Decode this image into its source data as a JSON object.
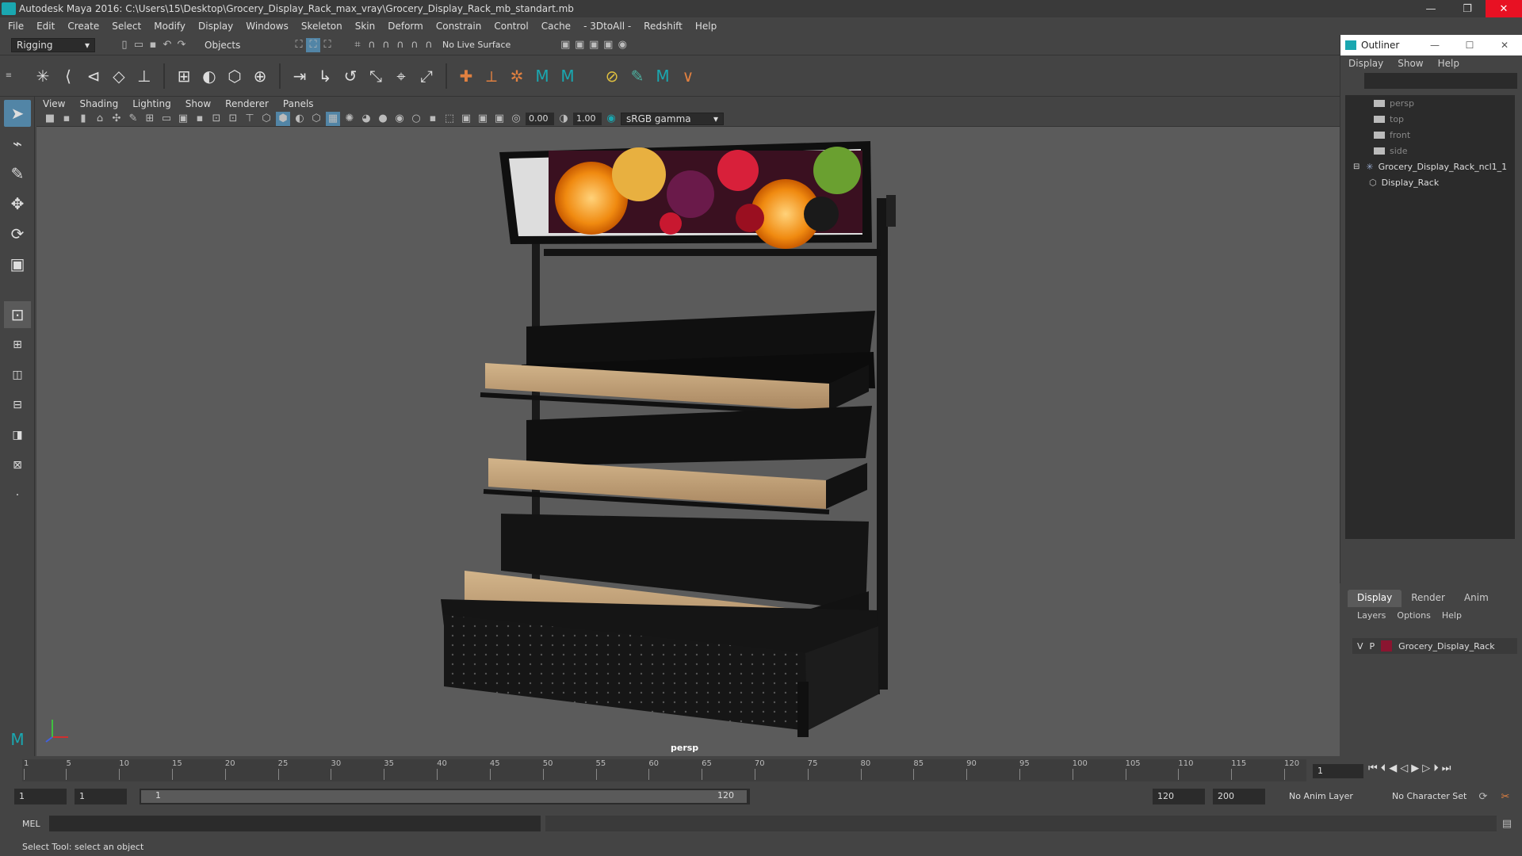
{
  "window": {
    "title": "Autodesk Maya 2016: C:\\Users\\15\\Desktop\\Grocery_Display_Rack_max_vray\\Grocery_Display_Rack_mb_standart.mb",
    "minimize": "—",
    "restore": "❐",
    "close": "✕"
  },
  "menubar": [
    "File",
    "Edit",
    "Create",
    "Select",
    "Modify",
    "Display",
    "Windows",
    "Skeleton",
    "Skin",
    "Deform",
    "Constrain",
    "Control",
    "Cache",
    "- 3DtoAll -",
    "Redshift",
    "Help"
  ],
  "statusline": {
    "mode": "Rigging",
    "select_mode": "Objects",
    "live_surface": "No Live Surface"
  },
  "viewport": {
    "menus": [
      "View",
      "Shading",
      "Lighting",
      "Show",
      "Renderer",
      "Panels"
    ],
    "exposure": "0.00",
    "gamma": "1.00",
    "colorspace": "sRGB gamma",
    "camera_label": "persp"
  },
  "outliner": {
    "title": "Outliner",
    "menus": [
      "Display",
      "Show",
      "Help"
    ],
    "items": [
      {
        "label": "persp",
        "dim": true
      },
      {
        "label": "top",
        "dim": true
      },
      {
        "label": "front",
        "dim": true
      },
      {
        "label": "side",
        "dim": true
      },
      {
        "label": "Grocery_Display_Rack_ncl1_1",
        "dim": false
      },
      {
        "label": "Display_Rack",
        "dim": false
      }
    ]
  },
  "layers": {
    "tabs": [
      "Display",
      "Render",
      "Anim"
    ],
    "menus": [
      "Layers",
      "Options",
      "Help"
    ],
    "row": {
      "v": "V",
      "p": "P",
      "name": "Grocery_Display_Rack",
      "color": "#8a1530"
    }
  },
  "timeline": {
    "ticks": [
      "1",
      "5",
      "10",
      "15",
      "20",
      "25",
      "30",
      "35",
      "40",
      "45",
      "50",
      "55",
      "60",
      "65",
      "70",
      "75",
      "80",
      "85",
      "90",
      "95",
      "100",
      "105",
      "110",
      "115",
      "120"
    ],
    "current_frame": "1"
  },
  "range": {
    "start": "1",
    "start_inner": "1",
    "slider_start": "1",
    "slider_end": "120",
    "end": "120",
    "end_total": "200",
    "anim_layer": "No Anim Layer",
    "char_set": "No Character Set"
  },
  "cmdline": {
    "label": "MEL"
  },
  "helpline": "Select Tool: select an object"
}
